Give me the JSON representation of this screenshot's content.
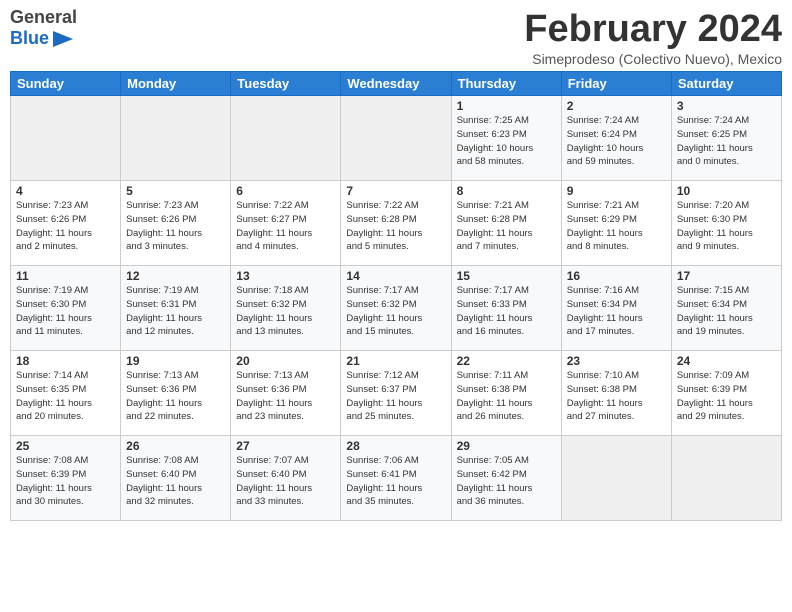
{
  "header": {
    "logo": {
      "general": "General",
      "blue": "Blue",
      "tagline": "GeneralBlue"
    },
    "title": "February 2024",
    "location": "Simeprodeso (Colectivo Nuevo), Mexico"
  },
  "calendar": {
    "weekdays": [
      "Sunday",
      "Monday",
      "Tuesday",
      "Wednesday",
      "Thursday",
      "Friday",
      "Saturday"
    ],
    "weeks": [
      {
        "days": [
          {
            "num": "",
            "info": ""
          },
          {
            "num": "",
            "info": ""
          },
          {
            "num": "",
            "info": ""
          },
          {
            "num": "",
            "info": ""
          },
          {
            "num": "1",
            "info": "Sunrise: 7:25 AM\nSunset: 6:23 PM\nDaylight: 10 hours\nand 58 minutes."
          },
          {
            "num": "2",
            "info": "Sunrise: 7:24 AM\nSunset: 6:24 PM\nDaylight: 10 hours\nand 59 minutes."
          },
          {
            "num": "3",
            "info": "Sunrise: 7:24 AM\nSunset: 6:25 PM\nDaylight: 11 hours\nand 0 minutes."
          }
        ]
      },
      {
        "days": [
          {
            "num": "4",
            "info": "Sunrise: 7:23 AM\nSunset: 6:26 PM\nDaylight: 11 hours\nand 2 minutes."
          },
          {
            "num": "5",
            "info": "Sunrise: 7:23 AM\nSunset: 6:26 PM\nDaylight: 11 hours\nand 3 minutes."
          },
          {
            "num": "6",
            "info": "Sunrise: 7:22 AM\nSunset: 6:27 PM\nDaylight: 11 hours\nand 4 minutes."
          },
          {
            "num": "7",
            "info": "Sunrise: 7:22 AM\nSunset: 6:28 PM\nDaylight: 11 hours\nand 5 minutes."
          },
          {
            "num": "8",
            "info": "Sunrise: 7:21 AM\nSunset: 6:28 PM\nDaylight: 11 hours\nand 7 minutes."
          },
          {
            "num": "9",
            "info": "Sunrise: 7:21 AM\nSunset: 6:29 PM\nDaylight: 11 hours\nand 8 minutes."
          },
          {
            "num": "10",
            "info": "Sunrise: 7:20 AM\nSunset: 6:30 PM\nDaylight: 11 hours\nand 9 minutes."
          }
        ]
      },
      {
        "days": [
          {
            "num": "11",
            "info": "Sunrise: 7:19 AM\nSunset: 6:30 PM\nDaylight: 11 hours\nand 11 minutes."
          },
          {
            "num": "12",
            "info": "Sunrise: 7:19 AM\nSunset: 6:31 PM\nDaylight: 11 hours\nand 12 minutes."
          },
          {
            "num": "13",
            "info": "Sunrise: 7:18 AM\nSunset: 6:32 PM\nDaylight: 11 hours\nand 13 minutes."
          },
          {
            "num": "14",
            "info": "Sunrise: 7:17 AM\nSunset: 6:32 PM\nDaylight: 11 hours\nand 15 minutes."
          },
          {
            "num": "15",
            "info": "Sunrise: 7:17 AM\nSunset: 6:33 PM\nDaylight: 11 hours\nand 16 minutes."
          },
          {
            "num": "16",
            "info": "Sunrise: 7:16 AM\nSunset: 6:34 PM\nDaylight: 11 hours\nand 17 minutes."
          },
          {
            "num": "17",
            "info": "Sunrise: 7:15 AM\nSunset: 6:34 PM\nDaylight: 11 hours\nand 19 minutes."
          }
        ]
      },
      {
        "days": [
          {
            "num": "18",
            "info": "Sunrise: 7:14 AM\nSunset: 6:35 PM\nDaylight: 11 hours\nand 20 minutes."
          },
          {
            "num": "19",
            "info": "Sunrise: 7:13 AM\nSunset: 6:36 PM\nDaylight: 11 hours\nand 22 minutes."
          },
          {
            "num": "20",
            "info": "Sunrise: 7:13 AM\nSunset: 6:36 PM\nDaylight: 11 hours\nand 23 minutes."
          },
          {
            "num": "21",
            "info": "Sunrise: 7:12 AM\nSunset: 6:37 PM\nDaylight: 11 hours\nand 25 minutes."
          },
          {
            "num": "22",
            "info": "Sunrise: 7:11 AM\nSunset: 6:38 PM\nDaylight: 11 hours\nand 26 minutes."
          },
          {
            "num": "23",
            "info": "Sunrise: 7:10 AM\nSunset: 6:38 PM\nDaylight: 11 hours\nand 27 minutes."
          },
          {
            "num": "24",
            "info": "Sunrise: 7:09 AM\nSunset: 6:39 PM\nDaylight: 11 hours\nand 29 minutes."
          }
        ]
      },
      {
        "days": [
          {
            "num": "25",
            "info": "Sunrise: 7:08 AM\nSunset: 6:39 PM\nDaylight: 11 hours\nand 30 minutes."
          },
          {
            "num": "26",
            "info": "Sunrise: 7:08 AM\nSunset: 6:40 PM\nDaylight: 11 hours\nand 32 minutes."
          },
          {
            "num": "27",
            "info": "Sunrise: 7:07 AM\nSunset: 6:40 PM\nDaylight: 11 hours\nand 33 minutes."
          },
          {
            "num": "28",
            "info": "Sunrise: 7:06 AM\nSunset: 6:41 PM\nDaylight: 11 hours\nand 35 minutes."
          },
          {
            "num": "29",
            "info": "Sunrise: 7:05 AM\nSunset: 6:42 PM\nDaylight: 11 hours\nand 36 minutes."
          },
          {
            "num": "",
            "info": ""
          },
          {
            "num": "",
            "info": ""
          }
        ]
      }
    ]
  }
}
